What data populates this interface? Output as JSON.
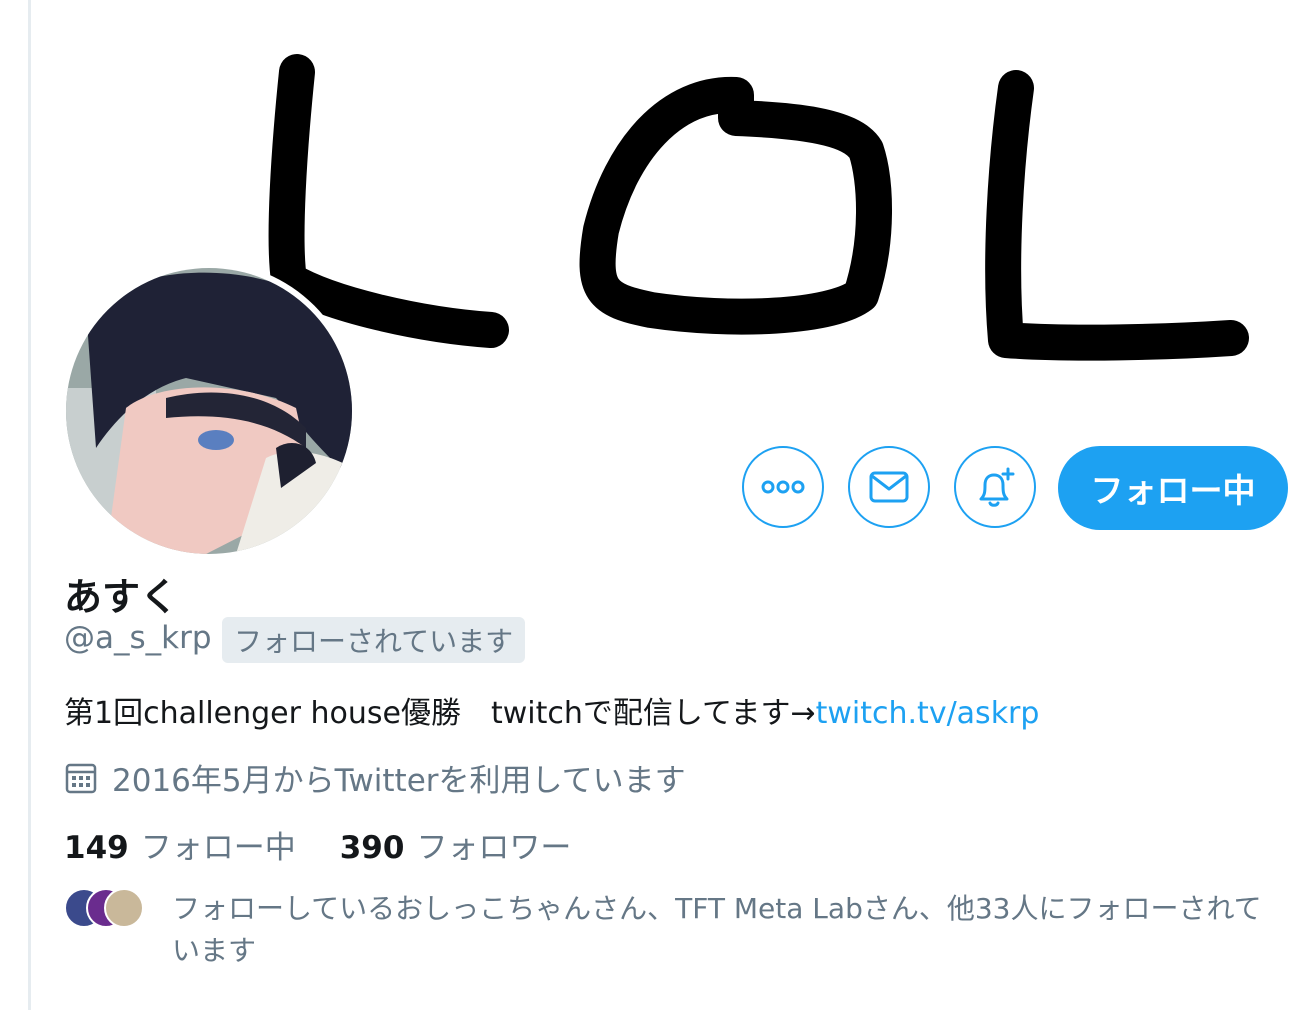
{
  "banner": {
    "drawing_text": "LOL"
  },
  "profile": {
    "name": "あすく",
    "handle": "@a_s_krp",
    "follows_you": "フォローされています",
    "bio_text": "第1回challenger house優勝　twitchで配信してます→",
    "bio_link": "twitch.tv/askrp",
    "joined": "2016年5月からTwitterを利用しています"
  },
  "actions": {
    "more_icon": "more-icon",
    "message_icon": "envelope-icon",
    "notify_icon": "bell-plus-icon",
    "follow_label": "フォロー中"
  },
  "stats": {
    "following_count": "149",
    "following_label": "フォロー中",
    "followers_count": "390",
    "followers_label": "フォロワー"
  },
  "mutuals": {
    "text": "フォローしているおしっこちゃんさん、TFT Meta Labさん、他33人にフォローされています"
  },
  "colors": {
    "accent": "#1da1f2",
    "muted": "#657786",
    "text": "#14171a"
  }
}
